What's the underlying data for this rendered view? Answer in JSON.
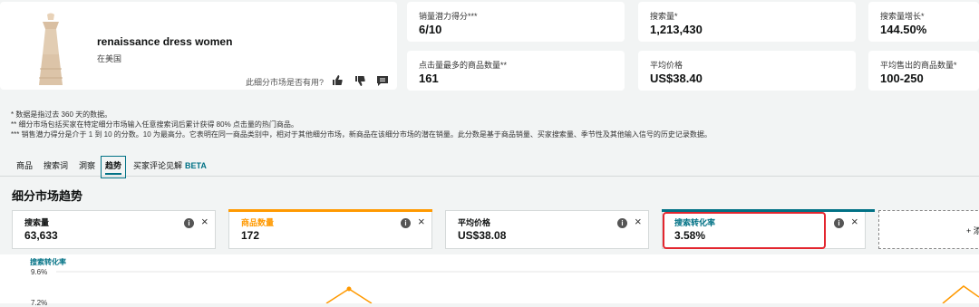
{
  "product": {
    "title": "renaissance dress women",
    "region": "在美国",
    "helpful_prompt": "此细分市场是否有用?"
  },
  "summary_metrics": [
    {
      "label": "销量潜力得分***",
      "value": "6/10"
    },
    {
      "label": "搜索量*",
      "value": "1,213,430"
    },
    {
      "label": "搜索量增长*",
      "value": "144.50%"
    },
    {
      "label": "点击量最多的商品数量**",
      "value": "161"
    },
    {
      "label": "平均价格",
      "value": "US$38.40"
    },
    {
      "label": "平均售出的商品数量*",
      "value": "100-250"
    }
  ],
  "footnotes": [
    "* 数据是指过去 360 天的数据。",
    "** 细分市场包括买家在特定细分市场输入任意搜索词后累计获得 80% 点击量的热门商品。",
    "*** 销售潜力得分是介于 1 到 10 的分数。10 为最高分。它表明在同一商品类别中，相对于其他细分市场，新商品在该细分市场的潜在销量。此分数是基于商品销量、买家搜索量、季节性及其他输入信号的历史记录数据。"
  ],
  "tabs": [
    {
      "label": "商品"
    },
    {
      "label": "搜索词"
    },
    {
      "label": "洞察"
    },
    {
      "label": "趋势"
    },
    {
      "label": "买家评论见解",
      "badge": "BETA"
    }
  ],
  "active_tab": "趋势",
  "section_title": "细分市场趋势",
  "trend_cards": [
    {
      "label": "搜索量",
      "value": "63,633",
      "accent": ""
    },
    {
      "label": "商品数量",
      "value": "172",
      "accent": "#ff9900"
    },
    {
      "label": "平均价格",
      "value": "US$38.08",
      "accent": ""
    },
    {
      "label": "搜索转化率",
      "value": "3.58%",
      "accent": "#007185"
    }
  ],
  "add_card_label": "+ 添",
  "chart": {
    "title": "搜索转化率",
    "ticks": [
      "9.6%",
      "7.2%"
    ]
  },
  "colors": {
    "accent_teal": "#007185",
    "accent_orange": "#ff9900",
    "highlight_red": "#e3262f"
  }
}
